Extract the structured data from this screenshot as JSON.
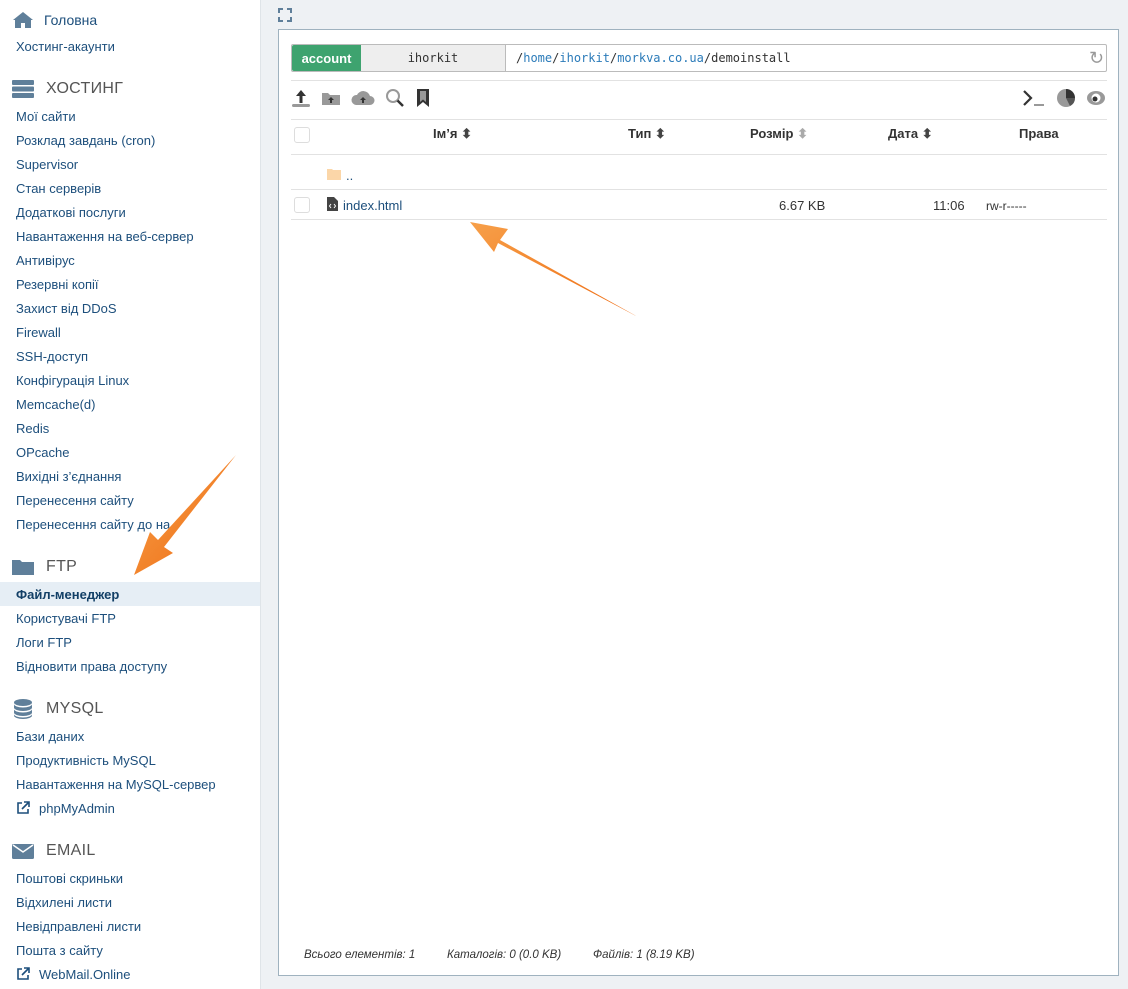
{
  "sidebar": {
    "home": "Головна",
    "hosting_accounts": "Хостинг-акаунти",
    "sections": [
      {
        "title": "ХОСТИНГ",
        "items": [
          "Мої сайти",
          "Розклад завдань (cron)",
          "Supervisor",
          "Стан серверів",
          "Додаткові послуги",
          "Навантаження на веб-сервер",
          "Антивірус",
          "Резервні копії",
          "Захист від DDoS",
          "Firewall",
          "SSH-доступ",
          "Конфігурація Linux",
          "Memcache(d)",
          "Redis",
          "OPcache",
          "Вихідні з’єднання",
          "Перенесення сайту",
          "Перенесення сайту до на"
        ]
      },
      {
        "title": "FTP",
        "items": [
          "Файл-менеджер",
          "Користувачі FTP",
          "Логи FTP",
          "Відновити права доступу"
        ]
      },
      {
        "title": "MYSQL",
        "items": [
          "Бази даних",
          "Продуктивність MySQL",
          "Навантаження на MySQL-сервер",
          "phpMyAdmin"
        ]
      },
      {
        "title": "EMAIL",
        "items": [
          "Поштові скриньки",
          "Відхилені листи",
          "Невідправлені листи",
          "Пошта з сайту",
          "WebMail.Online"
        ]
      }
    ]
  },
  "filemanager": {
    "account_label": "account",
    "user": "ihorkit",
    "path": {
      "parts": [
        "home",
        "ihorkit",
        "morkva.co.ua"
      ],
      "current": "demoinstall"
    },
    "columns": {
      "name": "Ім’я",
      "type": "Тип",
      "size": "Розмір",
      "date": "Дата",
      "perms": "Права"
    },
    "parent": "..",
    "files": [
      {
        "name": "index.html",
        "size": "6.67 KB",
        "date": "11:06",
        "perms": "rw-r-----"
      }
    ],
    "footer": {
      "total": "Всього елементів: 1",
      "dirs": "Каталогів: 0 (0.0 KB)",
      "files": "Файлів: 1 (8.19 KB)"
    }
  },
  "colors": {
    "accent": "#3ea36f",
    "link": "#1d4f7c",
    "annotation": "#f07a1a"
  }
}
